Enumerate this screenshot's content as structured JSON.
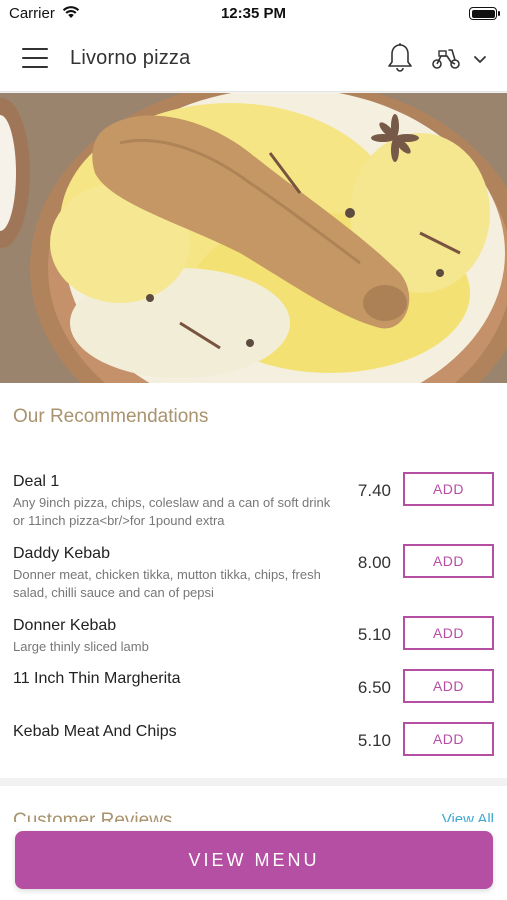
{
  "status_bar": {
    "carrier": "Carrier",
    "time": "12:35 PM"
  },
  "header": {
    "title": "Livorno pizza",
    "icons": [
      "menu-icon",
      "bell-icon",
      "scooter-icon",
      "chevron-down-icon"
    ]
  },
  "hero": {
    "image": "chicken-biryani-photo"
  },
  "recommendations": {
    "heading": "Our Recommendations",
    "items": [
      {
        "name": "Deal 1",
        "desc": "Any 9inch pizza, chips, coleslaw and a can of soft drink or 11inch pizza<br/>for 1pound extra",
        "price": "7.40",
        "add_label": "ADD"
      },
      {
        "name": "Daddy Kebab",
        "desc": "Donner meat, chicken tikka, mutton tikka, chips, fresh salad, chilli sauce and can of pepsi",
        "price": "8.00",
        "add_label": "ADD"
      },
      {
        "name": "Donner Kebab",
        "desc": "Large thinly sliced lamb",
        "price": "5.10",
        "add_label": "ADD"
      },
      {
        "name": "11 Inch Thin Margherita",
        "desc": "",
        "price": "6.50",
        "add_label": "ADD"
      },
      {
        "name": "Kebab Meat And Chips",
        "desc": "",
        "price": "5.10",
        "add_label": "ADD"
      }
    ]
  },
  "reviews": {
    "title": "Customer Reviews",
    "view_all": "View All"
  },
  "footer": {
    "view_menu_label": "VIEW MENU"
  },
  "colors": {
    "accent": "#b54fa4",
    "heading": "#a8936e",
    "link": "#3fa9d1"
  }
}
